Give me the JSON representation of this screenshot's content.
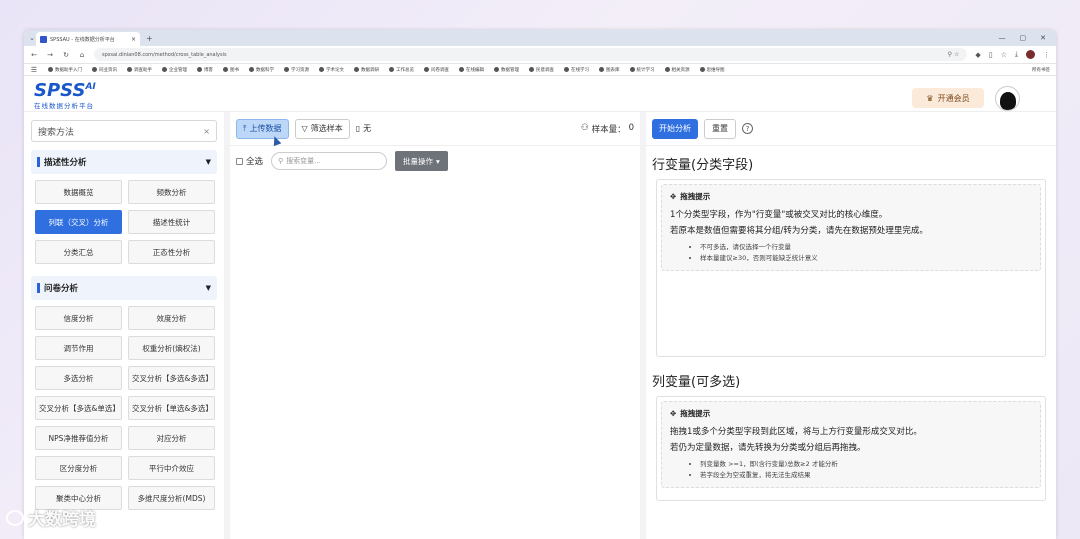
{
  "browser": {
    "tab_title": "SPSSAU - 在线数据分析平台",
    "url": "spssai.dinian08.com/method/cross_table_analysis",
    "bookmarks": [
      "数据助手入门",
      "同业资讯",
      "调查助手",
      "企业管理",
      "博客",
      "图书",
      "数据科学",
      "学习资源",
      "学术论文",
      "数据调研",
      "工作总览",
      "问卷调查",
      "在线编辑",
      "数据管理",
      "民意调查",
      "在线学习",
      "图表库",
      "统计学习",
      "相关资源",
      "思维导图"
    ],
    "bookmarks_right": "所有书签"
  },
  "app": {
    "logo_text": "SPSS",
    "logo_ai": "AI",
    "logo_sub": "在线数据分析平台",
    "vip_label": "开通会员"
  },
  "sidebar": {
    "search_placeholder": "搜索方法",
    "groups": [
      {
        "title": "描述性分析",
        "items": [
          "数据概览",
          "频数分析",
          "列联（交叉）分析",
          "描述性统计",
          "分类汇总",
          "正态性分析"
        ]
      },
      {
        "title": "问卷分析",
        "items": [
          "信度分析",
          "效度分析",
          "调节作用",
          "权重分析(熵权法)",
          "多选分析",
          "交叉分析【多选&多选】",
          "交叉分析【多选&单选】",
          "交叉分析【单选&多选】",
          "NPS净推荐值分析",
          "对应分析",
          "区分度分析",
          "平行中介效应",
          "聚类中心分析",
          "多维尺度分析(MDS)"
        ]
      }
    ]
  },
  "center": {
    "upload_label": "上传数据",
    "filter_label": "筛选样本",
    "file_label": "无",
    "sample_label": "样本量：",
    "sample_count": "0",
    "select_all": "全选",
    "search_placeholder": "搜索变量...",
    "batch_label": "批量操作"
  },
  "right": {
    "run_label": "开始分析",
    "reset_label": "重置",
    "row_title": "行变量(分类字段)",
    "row_tip_head": "拖拽提示",
    "row_tip_l1": "1个分类型字段，作为\"行变量\"或被交叉对比的核心维度。",
    "row_tip_l2": "若原本是数值但需要将其分组/转为分类，请先在数据预处理里完成。",
    "row_tip_bullets": [
      "不可多选，请仅选择一个行变量",
      "样本量建议≥30，否则可能缺乏统计意义"
    ],
    "col_title": "列变量(可多选)",
    "col_tip_head": "拖拽提示",
    "col_tip_l1": "拖拽1或多个分类型字段到此区域，将与上方行变量形成交叉对比。",
    "col_tip_l2": "若仍为定量数据，请先转换为分类或分组后再拖拽。",
    "col_tip_bullets": [
      "列变量数 >=1，即(含行变量)总数≥2 才能分析",
      "若字段全为空或重复，将无法生成结果"
    ]
  },
  "watermark": "大数跨境"
}
